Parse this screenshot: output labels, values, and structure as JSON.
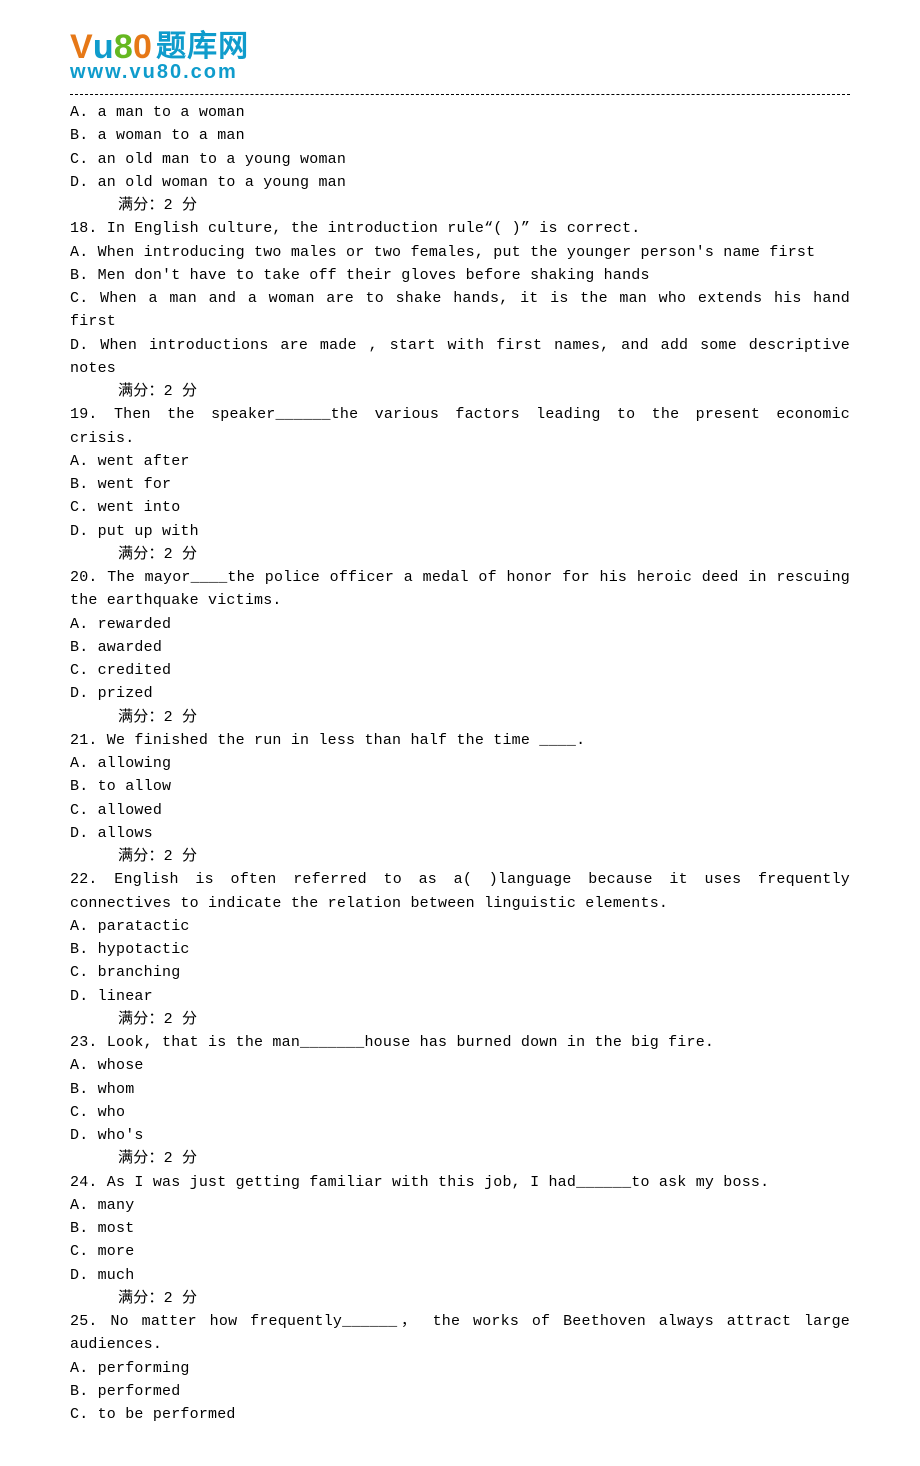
{
  "logo": {
    "v": "V",
    "u": "u",
    "8": "8",
    "0": "0",
    "cn": "题库网",
    "url": "www.vu80.com"
  },
  "q17": {
    "optA": "A. a man to a woman",
    "optB": "B. a woman to a man",
    "optC": "C. an old man to a young woman",
    "optD": "D. an old woman to a young man",
    "score": "满分：2  分"
  },
  "q18": {
    "stem": "18.  In English culture, the introduction rule“( )” is correct.",
    "optA": "A. When introducing two males or two females, put the younger person's name first",
    "optB": "B. Men don't have to take off their gloves before shaking hands",
    "optC": "C. When a man and a woman are to shake hands, it is the man who extends his hand first",
    "optD": "D. When introductions are made , start with first names, and add some descriptive notes",
    "score": "满分：2  分"
  },
  "q19": {
    "stem": "19.  Then the speaker______the various factors leading to the present economic crisis.",
    "optA": "A. went after",
    "optB": "B. went for",
    "optC": "C. went into",
    "optD": "D. put up with",
    "score": "满分：2  分"
  },
  "q20": {
    "stem": "20.  The mayor____the police officer a medal of honor for his heroic deed in rescuing the earthquake victims.",
    "optA": "A. rewarded",
    "optB": "B. awarded",
    "optC": "C. credited",
    "optD": "D. prized",
    "score": "满分：2  分"
  },
  "q21": {
    "stem": "21.  We finished the run in less than half the time ____.",
    "optA": "A. allowing",
    "optB": "B. to allow",
    "optC": "C. allowed",
    "optD": "D. allows",
    "score": "满分：2  分"
  },
  "q22": {
    "stem": "22.  English is often referred to as a( )language because it uses frequently connectives to indicate the relation between linguistic elements.",
    "optA": "A. paratactic",
    "optB": "B. hypotactic",
    "optC": "C. branching",
    "optD": "D. linear",
    "score": "满分：2  分"
  },
  "q23": {
    "stem": "23.  Look, that is the man_______house has burned down in the big fire.",
    "optA": "A. whose",
    "optB": "B. whom",
    "optC": "C. who",
    "optD": "D. who's",
    "score": "满分：2  分"
  },
  "q24": {
    "stem": "24.  As I was just getting familiar with this job, I had______to ask my boss.",
    "optA": "A. many",
    "optB": "B. most",
    "optC": "C. more",
    "optD": "D. much",
    "score": "满分：2  分"
  },
  "q25": {
    "stem": "25.  No matter how frequently______， the works of Beethoven always attract large audiences.",
    "optA": "A. performing",
    "optB": "B. performed",
    "optC": "C. to be performed"
  }
}
